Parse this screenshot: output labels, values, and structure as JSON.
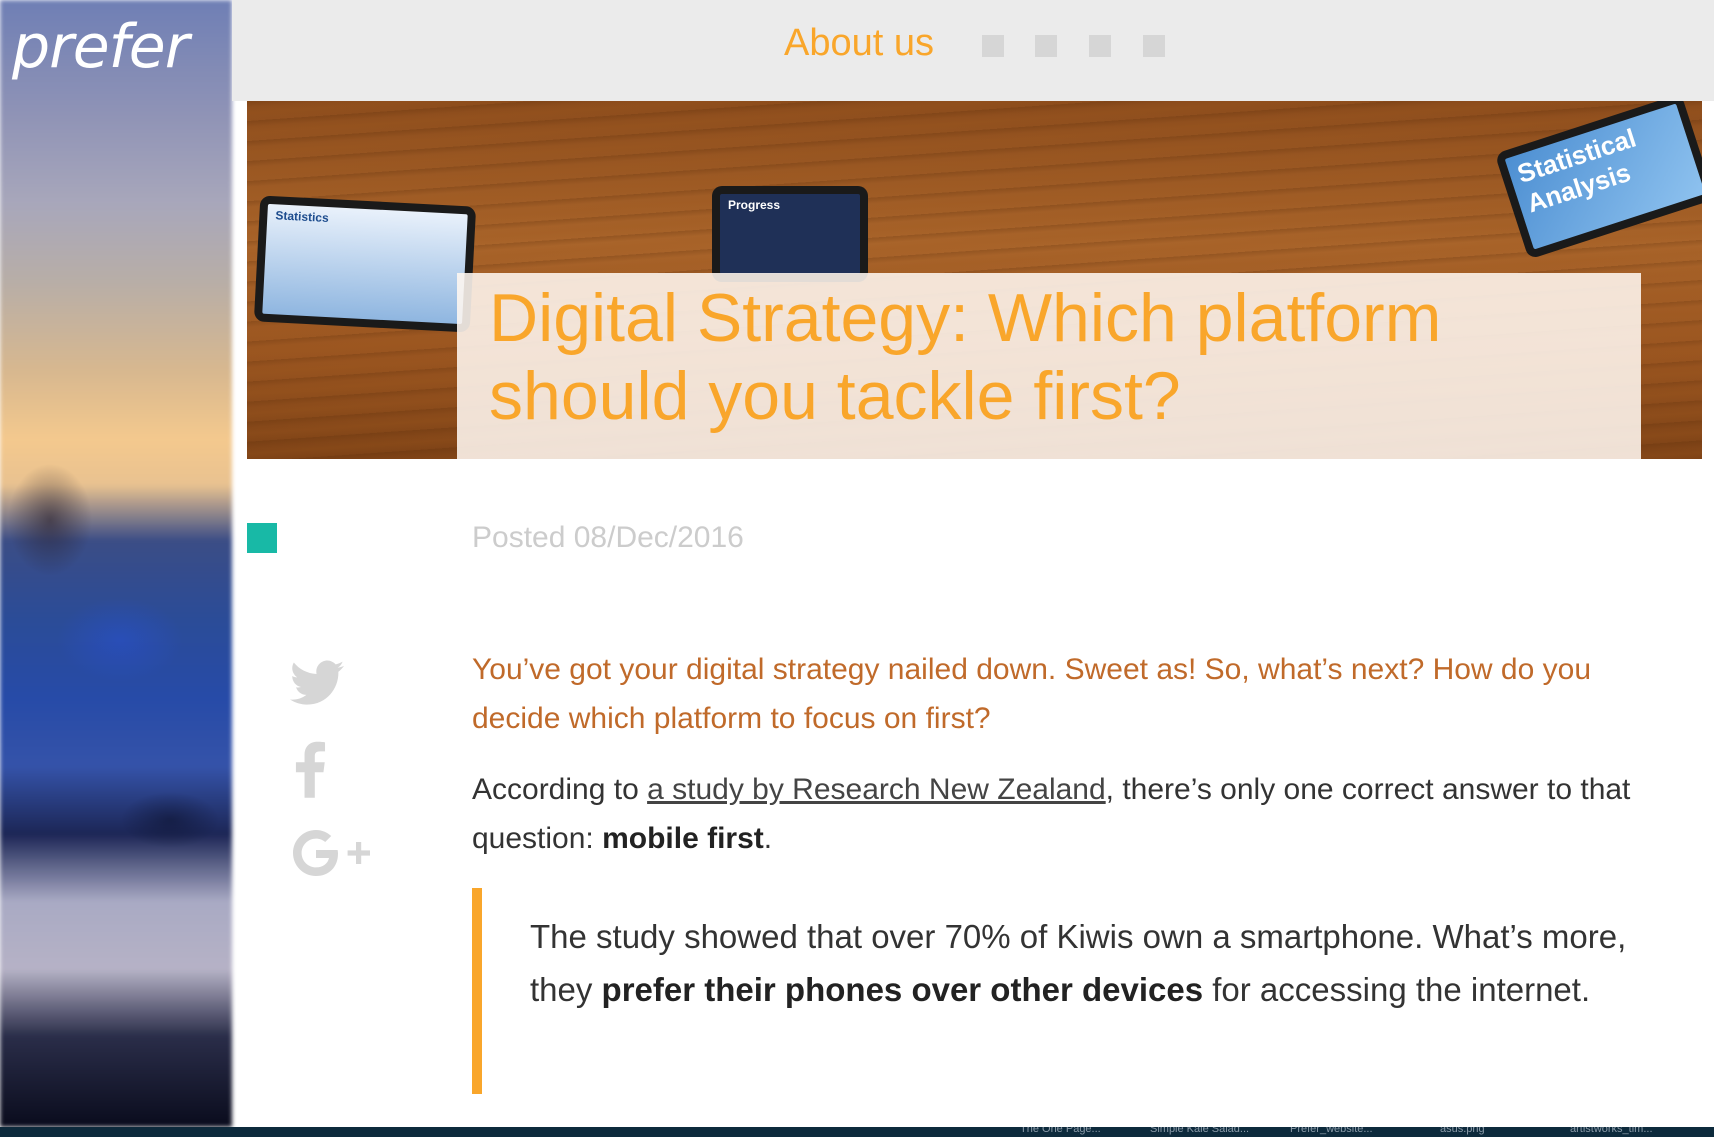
{
  "brand": {
    "logo_text": "prefer"
  },
  "header": {
    "nav_label": "About us",
    "nav_dots": [
      "nav-dot-1",
      "nav-dot-2",
      "nav-dot-3",
      "nav-dot-4"
    ]
  },
  "hero": {
    "title": "Digital Strategy: Which platform should you tackle first?",
    "tablet_labels": [
      "Statistics",
      "Progress",
      "Statistical Analysis"
    ]
  },
  "post": {
    "posted": "Posted 08/Dec/2016"
  },
  "social": {
    "icons": [
      "twitter-icon",
      "facebook-icon",
      "google-plus-icon"
    ]
  },
  "article": {
    "intro": "You’ve got your digital strategy nailed down. Sweet as! So, what’s next? How do you decide which platform to focus on first?",
    "para_prefix": "According to ",
    "para_link": "a study by Research New Zealand",
    "para_middle": ", there’s only one correct answer to that question: ",
    "para_bold": "mobile first",
    "para_suffix": ".",
    "quote_prefix": "The study showed that over 70% of Kiwis own a smartphone. What’s more, they ",
    "quote_bold": "prefer their phones over other devices",
    "quote_suffix": " for accessing the internet."
  },
  "taskbar": {
    "items": [
      "The One Page...",
      "Simple Kale Salad...",
      "Prefer_website...",
      "asus.png",
      "artistworks_tim..."
    ]
  },
  "colors": {
    "accent_orange": "#f9a62b",
    "intro_orange": "#c06a2a",
    "teal": "#18b9a6",
    "header_bg": "#ebebeb",
    "muted_gray": "#cccccc"
  }
}
